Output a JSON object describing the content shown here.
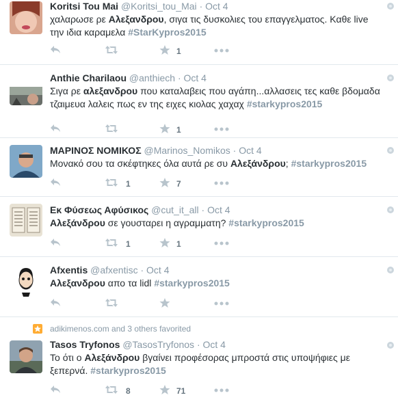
{
  "colors": {
    "text": "#292f33",
    "meta": "#8899a6",
    "border": "#e1e8ed",
    "favorite_badge": "#ffac33"
  },
  "tweets": [
    {
      "fullname": "Koritsi Tou Mai",
      "handle": "@Koritsi_tou_Mai",
      "dot": "·",
      "time": "Oct 4",
      "text_parts": [
        {
          "t": "χαλαρωσε ρε ",
          "s": "n"
        },
        {
          "t": "Αλεξανδρου",
          "s": "b"
        },
        {
          "t": ", σιγα τις δυσκολιες του επαγγελματος. Καθε live την ιδια καραμελα ",
          "s": "n"
        },
        {
          "t": "#StarKypros2015",
          "s": "h"
        }
      ],
      "retweets": "",
      "favorites": "1"
    },
    {
      "fullname": "Anthie Charilaou",
      "handle": "@anthiech",
      "dot": "·",
      "time": "Oct 4",
      "text_parts": [
        {
          "t": "Σιγα ρε ",
          "s": "n"
        },
        {
          "t": "αλεξανδρου",
          "s": "b"
        },
        {
          "t": " που καταλαβεις που αγάπη...αλλασεις τες καθε βδομαδα τζαιμευα  λαλεις πως εν της ειχες κιολας χαχαχ ",
          "s": "n"
        },
        {
          "t": "#starkypros2015",
          "s": "h"
        }
      ],
      "retweets": "",
      "favorites": "1"
    },
    {
      "fullname": "ΜΑΡΙΝΟΣ ΝΟΜΙΚΟΣ",
      "handle": "@Marinos_Nomikos",
      "dot": "·",
      "time": "Oct 4",
      "text_parts": [
        {
          "t": "Μονακό σου τα σκέφτηκες όλα αυτά ρε συ ",
          "s": "n"
        },
        {
          "t": "Αλεξάνδρου",
          "s": "b"
        },
        {
          "t": "; ",
          "s": "n"
        },
        {
          "t": "#starkypros2015",
          "s": "h"
        }
      ],
      "retweets": "1",
      "favorites": "7"
    },
    {
      "fullname": "Εκ Φύσεως Αφύσικος",
      "handle": "@cut_it_all",
      "dot": "·",
      "time": "Oct 4",
      "text_parts": [
        {
          "t": "Αλεξάνδρου",
          "s": "b"
        },
        {
          "t": " σε γουσταρει η αγραμματη? ",
          "s": "n"
        },
        {
          "t": "#starkypros2015",
          "s": "h"
        }
      ],
      "retweets": "1",
      "favorites": "1"
    },
    {
      "fullname": "Afxentis",
      "handle": "@afxentisc",
      "dot": "·",
      "time": "Oct 4",
      "text_parts": [
        {
          "t": "Αλεξανδρου",
          "s": "b"
        },
        {
          "t": " απο τα lidl ",
          "s": "n"
        },
        {
          "t": "#starkypros2015",
          "s": "h"
        }
      ],
      "retweets": "",
      "favorites": ""
    },
    {
      "context": "adikimenos.com and 3 others favorited",
      "fullname": "Tasos Tryfonos",
      "handle": "@TasosTryfonos",
      "dot": "·",
      "time": "Oct 4",
      "text_parts": [
        {
          "t": "Το ότι ο ",
          "s": "n"
        },
        {
          "t": "Αλεξάνδρου",
          "s": "b"
        },
        {
          "t": " βγαίνει προφέσορας μπροστά στις υποψήφιες με ξεπερνά. ",
          "s": "n"
        },
        {
          "t": "#starkypros2015",
          "s": "h"
        }
      ],
      "retweets": "8",
      "favorites": "71"
    }
  ]
}
